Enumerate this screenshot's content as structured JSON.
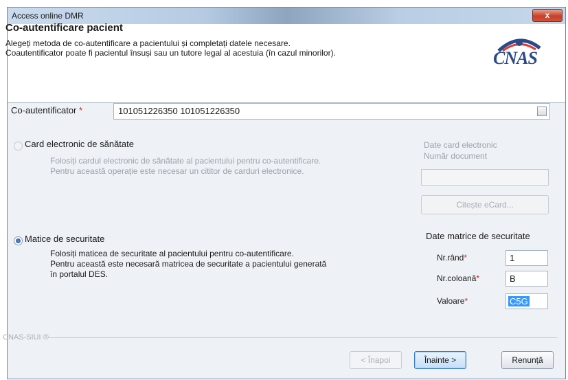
{
  "window": {
    "title": "Access online DMR",
    "close_glyph": "x"
  },
  "header": {
    "title": "Co-autentificare pacient",
    "line1": "Alegeți metoda de co-autentificare a pacientului și completați datele necesare.",
    "line2": "Coautentificator poate fi pacientul însuși sau un tutore legal al acestuia (în cazul minorilor).",
    "logo_text": "CNAS",
    "logo_icon": "cnas-logo-icon"
  },
  "coauth": {
    "label": "Co-autentificator",
    "required": "*",
    "value": "101051226350 101051226350",
    "button_icon": "ellipsis-icon"
  },
  "card_option": {
    "label": "Card electronic de sănătate",
    "desc1": "Folosiți cardul electronic de sănătate al pacientului pentru co-autentificare.",
    "desc2": "Pentru această operație este necesar un cititor de carduri electronice.",
    "data_title": "Date card electronic",
    "doc_label": "Număr document",
    "doc_value": "",
    "read_button": "Citește eCard..."
  },
  "matrix_option": {
    "label": "Matice de securitate",
    "desc1": "Folosiți maticea de securitate al pacientului pentru co-autentificare.",
    "desc2": "Pentru această este necesară matricea de securitate a pacientului generată",
    "desc3": "în portalul DES.",
    "data_title": "Date matrice de securitate",
    "row_label": "Nr.rând",
    "row_value": "1",
    "col_label": "Nr.coloană",
    "col_value": "B",
    "val_label": "Valoare",
    "val_value": "C5G",
    "required": "*"
  },
  "footer": {
    "brand": "CNAS-SIUI ®",
    "back": "< Înapoi",
    "next": "Înainte >",
    "cancel": "Renunță"
  }
}
